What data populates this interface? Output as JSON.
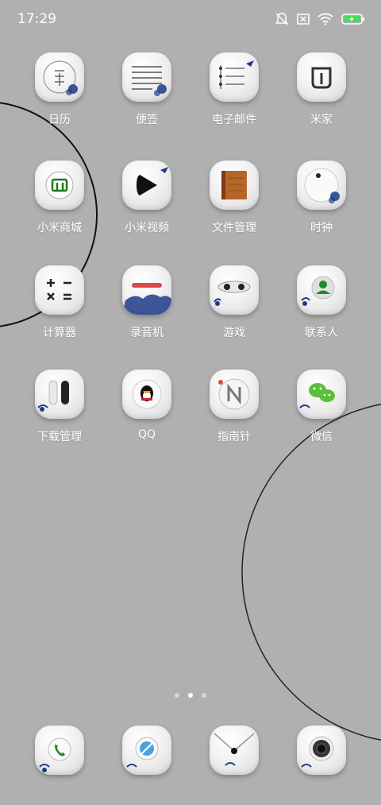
{
  "status_bar": {
    "time": "17:29",
    "icons": [
      "bell-muted-icon",
      "sim-x-icon",
      "wifi-icon",
      "battery-charging-icon"
    ],
    "battery_color": "#4cd964"
  },
  "apps": [
    {
      "label": "日历",
      "icon": "calendar-icon"
    },
    {
      "label": "便签",
      "icon": "notes-icon"
    },
    {
      "label": "电子邮件",
      "icon": "email-icon"
    },
    {
      "label": "米家",
      "icon": "mijia-icon"
    },
    {
      "label": "小米商城",
      "icon": "mi-store-icon"
    },
    {
      "label": "小米视频",
      "icon": "video-play-icon"
    },
    {
      "label": "文件管理",
      "icon": "file-manager-icon"
    },
    {
      "label": "时钟",
      "icon": "clock-icon"
    },
    {
      "label": "计算器",
      "icon": "calculator-icon"
    },
    {
      "label": "录音机",
      "icon": "recorder-icon"
    },
    {
      "label": "游戏",
      "icon": "game-icon"
    },
    {
      "label": "联系人",
      "icon": "contacts-icon"
    },
    {
      "label": "下载管理",
      "icon": "download-icon"
    },
    {
      "label": "QQ",
      "icon": "qq-icon"
    },
    {
      "label": "指南针",
      "icon": "compass-icon"
    },
    {
      "label": "微信",
      "icon": "wechat-icon"
    }
  ],
  "page_indicator": {
    "count": 3,
    "active_index": 1
  },
  "dock": [
    {
      "icon": "phone-icon"
    },
    {
      "icon": "browser-icon"
    },
    {
      "icon": "messages-icon"
    },
    {
      "icon": "camera-icon"
    }
  ],
  "colors": {
    "background": "#b0b0b0",
    "porcelain_blue": "#1f3a8a",
    "label": "#ffffff"
  }
}
